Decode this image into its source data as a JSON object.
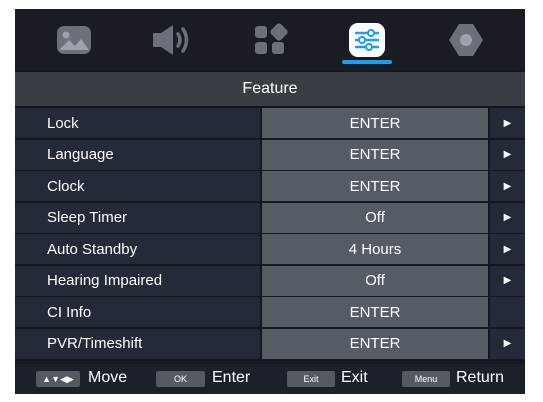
{
  "tabs": [
    {
      "name": "picture",
      "icon": "picture-icon",
      "active": false
    },
    {
      "name": "sound",
      "icon": "speaker-icon",
      "active": false
    },
    {
      "name": "channel",
      "icon": "apps-icon",
      "active": false
    },
    {
      "name": "feature",
      "icon": "sliders-icon",
      "active": true
    },
    {
      "name": "setup",
      "icon": "settings-icon",
      "active": false
    }
  ],
  "title": "Feature",
  "rows": [
    {
      "label": "Lock",
      "value": "ENTER",
      "arrow": "▶"
    },
    {
      "label": "Language",
      "value": "ENTER",
      "arrow": "▶"
    },
    {
      "label": "Clock",
      "value": "ENTER",
      "arrow": "▶"
    },
    {
      "label": "Sleep Timer",
      "value": "Off",
      "arrow": "▶"
    },
    {
      "label": "Auto Standby",
      "value": "4 Hours",
      "arrow": "▶"
    },
    {
      "label": "Hearing Impaired",
      "value": "Off",
      "arrow": "▶"
    },
    {
      "label": "CI Info",
      "value": "ENTER",
      "arrow": ""
    },
    {
      "label": "PVR/Timeshift",
      "value": "ENTER",
      "arrow": "▶"
    }
  ],
  "footer": {
    "move_keys": "▲▼◀▶",
    "move_label": "Move",
    "ok_key": "OK",
    "ok_label": "Enter",
    "exit_key": "Exit",
    "exit_label": "Exit",
    "menu_key": "Menu",
    "menu_label": "Return"
  },
  "colors": {
    "background": "#14171d",
    "title_bar": "#393e44",
    "label_cell": "#242a38",
    "value_cell": "#565c63",
    "accent": "#1a9ff0",
    "icon_inactive": "#6b7079",
    "icon_active": "#ffffff"
  }
}
